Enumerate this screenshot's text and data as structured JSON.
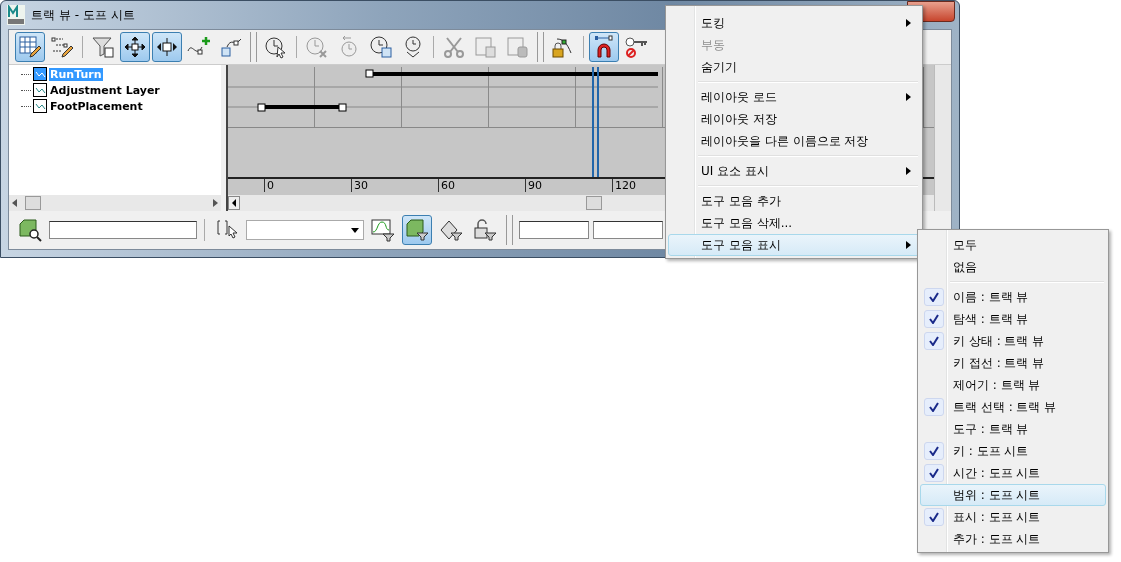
{
  "window": {
    "title": "트랙 뷰 - 도프 시트"
  },
  "toolbar": [
    {
      "kind": "edit-keys",
      "selected": true
    },
    {
      "kind": "edit-ranges",
      "selected": false
    },
    {
      "kind": "sep"
    },
    {
      "kind": "filter",
      "selected": false
    },
    {
      "kind": "move",
      "selected": true
    },
    {
      "kind": "slide",
      "selected": true
    },
    {
      "kind": "add-key",
      "selected": false
    },
    {
      "kind": "scale",
      "selected": false
    },
    {
      "kind": "bar"
    },
    {
      "kind": "select-time",
      "selected": false
    },
    {
      "kind": "sep"
    },
    {
      "kind": "delete-time",
      "selected": false
    },
    {
      "kind": "reverse-time",
      "selected": false
    },
    {
      "kind": "scale-time",
      "selected": false
    },
    {
      "kind": "insert-time",
      "selected": false
    },
    {
      "kind": "sep"
    },
    {
      "kind": "cut",
      "selected": false
    },
    {
      "kind": "copy",
      "selected": false
    },
    {
      "kind": "paste",
      "selected": false
    },
    {
      "kind": "bar"
    },
    {
      "kind": "lock",
      "selected": false
    },
    {
      "kind": "sep"
    },
    {
      "kind": "snap",
      "selected": true
    },
    {
      "kind": "key-off",
      "selected": false
    }
  ],
  "tree": [
    {
      "label": "RunTurn",
      "selected": true
    },
    {
      "label": "Adjustment Layer",
      "selected": false
    },
    {
      "label": "FootPlacement",
      "selected": false
    }
  ],
  "ruler": [
    "0",
    "30",
    "60",
    "90",
    "120"
  ],
  "bottom_toolbar": [
    {
      "kind": "zoom-object",
      "selected": false
    },
    {
      "kind": "field"
    },
    {
      "kind": "sep"
    },
    {
      "kind": "name-select",
      "selected": false
    },
    {
      "kind": "combo"
    },
    {
      "kind": "curve-filter",
      "selected": false
    },
    {
      "kind": "object-filter",
      "selected": true
    },
    {
      "kind": "anim-filter",
      "selected": false
    },
    {
      "kind": "lock-filter",
      "selected": false
    },
    {
      "kind": "bar"
    },
    {
      "kind": "field"
    },
    {
      "kind": "field"
    }
  ],
  "context_menu": [
    {
      "label": "도킹",
      "submenu": true,
      "disabled": false,
      "selected": false
    },
    {
      "label": "부동",
      "submenu": false,
      "disabled": true,
      "selected": false
    },
    {
      "label": "숨기기",
      "submenu": false,
      "disabled": false,
      "selected": false
    },
    {
      "kind": "separator"
    },
    {
      "label": "레이아웃 로드",
      "submenu": true,
      "disabled": false,
      "selected": false
    },
    {
      "label": "레이아웃 저장",
      "submenu": false,
      "disabled": false,
      "selected": false
    },
    {
      "label": "레이아웃을 다른 이름으로 저장",
      "submenu": false,
      "disabled": false,
      "selected": false
    },
    {
      "kind": "separator"
    },
    {
      "label": "UI 요소 표시",
      "submenu": true,
      "disabled": false,
      "selected": false
    },
    {
      "kind": "separator"
    },
    {
      "label": "도구 모음 추가",
      "submenu": false,
      "disabled": false,
      "selected": false
    },
    {
      "label": "도구 모음 삭제...",
      "submenu": false,
      "disabled": false,
      "selected": false
    },
    {
      "label": "도구 모음 표시",
      "submenu": true,
      "disabled": false,
      "selected": true
    }
  ],
  "submenu": [
    {
      "label": "모두",
      "checked": false,
      "selected": false
    },
    {
      "label": "없음",
      "checked": false,
      "selected": false
    },
    {
      "kind": "separator"
    },
    {
      "label": "이름 : 트랙 뷰",
      "checked": true,
      "selected": false
    },
    {
      "label": "탐색 : 트랙 뷰",
      "checked": true,
      "selected": false
    },
    {
      "label": "키 상태 : 트랙 뷰",
      "checked": true,
      "selected": false
    },
    {
      "label": "키 접선 : 트랙 뷰",
      "checked": false,
      "selected": false
    },
    {
      "label": "제어기 : 트랙 뷰",
      "checked": false,
      "selected": false
    },
    {
      "label": "트랙 선택 : 트랙 뷰",
      "checked": true,
      "selected": false
    },
    {
      "label": "도구 : 트랙 뷰",
      "checked": false,
      "selected": false
    },
    {
      "label": "키 : 도프 시트",
      "checked": true,
      "selected": false
    },
    {
      "label": "시간 : 도프 시트",
      "checked": true,
      "selected": false
    },
    {
      "label": "범위 : 도프 시트",
      "checked": false,
      "selected": true
    },
    {
      "label": "표시 : 도프 시트",
      "checked": true,
      "selected": false
    },
    {
      "label": "추가 : 도프 시트",
      "checked": false,
      "selected": false
    }
  ]
}
